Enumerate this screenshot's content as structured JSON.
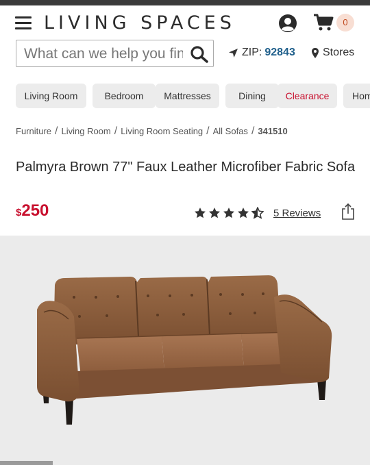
{
  "brand": {
    "name": "LIVING SPACES"
  },
  "header": {
    "cart_count": "0",
    "search_placeholder": "What can we help you find?",
    "zip_label": "ZIP:",
    "zip_value": "92843",
    "stores_label": "Stores"
  },
  "categories": [
    "Living Room",
    "Bedroom",
    "Mattresses",
    "Dining",
    "Clearance",
    "Home"
  ],
  "breadcrumbs": [
    "Furniture",
    "Living Room",
    "Living Room Seating",
    "All Sofas"
  ],
  "sku": "341510",
  "product": {
    "title": "Palmyra Brown 77\" Faux Leather Microfiber Fabric Sofa",
    "currency": "$",
    "price": "250",
    "rating": 4.5,
    "reviews_label": "5 Reviews"
  },
  "colors": {
    "accent_red": "#c8102e",
    "zip_blue": "#1f5f8b",
    "badge_bg": "#f8ded3"
  }
}
